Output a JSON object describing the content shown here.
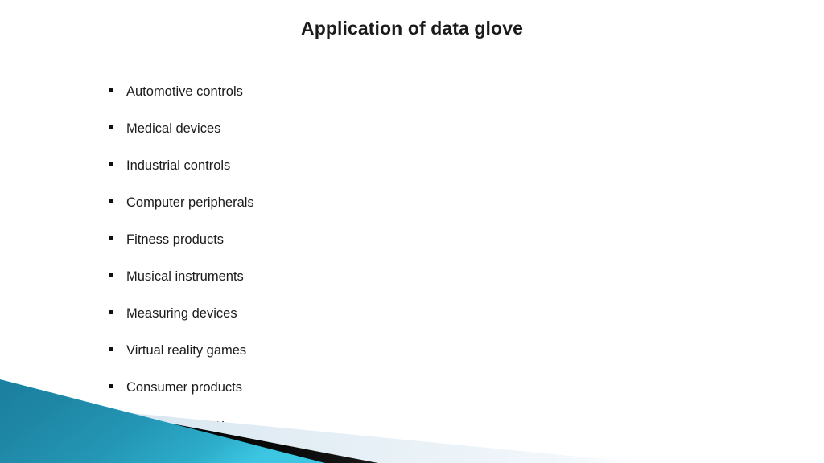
{
  "slide": {
    "title": "Application of data glove",
    "background_color": "#ffffff",
    "text_color": "#1a1a1a"
  },
  "content": {
    "bullet_marker": "square-bullet",
    "items": [
      {
        "label": "Automotive controls"
      },
      {
        "label": "Medical devices"
      },
      {
        "label": "Industrial controls"
      },
      {
        "label": "Computer peripherals"
      },
      {
        "label": "Fitness products"
      },
      {
        "label": "Musical instruments"
      },
      {
        "label": "Measuring devices"
      },
      {
        "label": "Virtual reality games"
      },
      {
        "label": "Consumer products"
      },
      {
        "label": "Physical therapy"
      }
    ]
  },
  "decoration": {
    "name": "bottom-diagonal-wedges",
    "pale_band_color": "#e2edf4",
    "pale_band_edge_color": "#cfe0ec",
    "black_stripe_color": "#050505",
    "teal_dark_color": "#10708f",
    "teal_mid_color": "#2189a8",
    "teal_bright_color": "#35bede"
  }
}
